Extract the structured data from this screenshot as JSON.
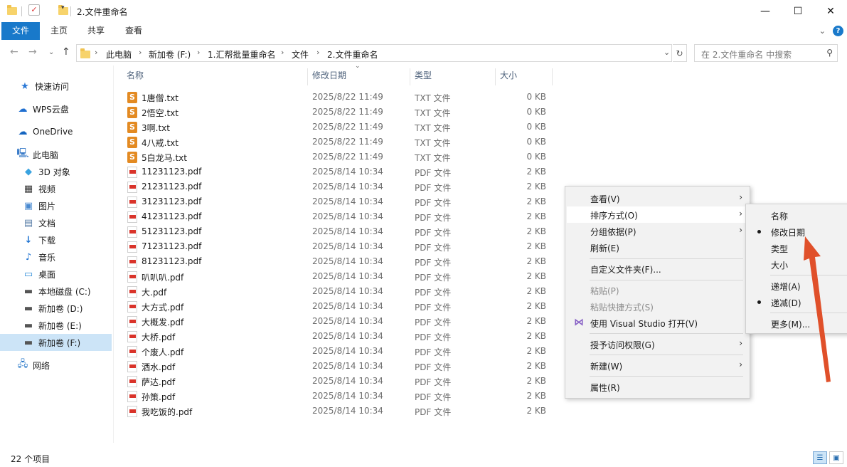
{
  "window": {
    "title": "2.文件重命名",
    "minimize": "—",
    "maximize": "☐",
    "close": "✕"
  },
  "ribbon": {
    "tabs": [
      "文件",
      "主页",
      "共享",
      "查看"
    ],
    "help": "?"
  },
  "address": {
    "segments": [
      "此电脑",
      "新加卷 (F:)",
      "1.汇帮批量重命名",
      "文件",
      "2.文件重命名"
    ],
    "search_placeholder": "在 2.文件重命名 中搜索"
  },
  "nav": {
    "items": [
      {
        "label": "快速访问",
        "icon": "star-icon"
      },
      {
        "label": "WPS云盘",
        "icon": "cloud-icon"
      },
      {
        "label": "OneDrive",
        "icon": "onedrive-icon"
      },
      {
        "label": "此电脑",
        "icon": "computer-icon"
      },
      {
        "label": "3D 对象",
        "icon": "cube-icon"
      },
      {
        "label": "视频",
        "icon": "film-icon"
      },
      {
        "label": "图片",
        "icon": "picture-icon"
      },
      {
        "label": "文档",
        "icon": "document-icon"
      },
      {
        "label": "下载",
        "icon": "download-icon"
      },
      {
        "label": "音乐",
        "icon": "music-icon"
      },
      {
        "label": "桌面",
        "icon": "desktop-icon"
      },
      {
        "label": "本地磁盘 (C:)",
        "icon": "drive-icon"
      },
      {
        "label": "新加卷 (D:)",
        "icon": "drive-icon"
      },
      {
        "label": "新加卷 (E:)",
        "icon": "drive-icon"
      },
      {
        "label": "新加卷 (F:)",
        "icon": "drive-icon"
      },
      {
        "label": "网络",
        "icon": "network-icon"
      }
    ]
  },
  "columns": [
    "名称",
    "修改日期",
    "类型",
    "大小"
  ],
  "files": [
    {
      "name": "1唐僧.txt",
      "date": "2025/8/22 11:49",
      "type": "TXT 文件",
      "size": "0 KB",
      "kind": "txt"
    },
    {
      "name": "2悟空.txt",
      "date": "2025/8/22 11:49",
      "type": "TXT 文件",
      "size": "0 KB",
      "kind": "txt"
    },
    {
      "name": "3啊.txt",
      "date": "2025/8/22 11:49",
      "type": "TXT 文件",
      "size": "0 KB",
      "kind": "txt"
    },
    {
      "name": "4八戒.txt",
      "date": "2025/8/22 11:49",
      "type": "TXT 文件",
      "size": "0 KB",
      "kind": "txt"
    },
    {
      "name": "5白龙马.txt",
      "date": "2025/8/22 11:49",
      "type": "TXT 文件",
      "size": "0 KB",
      "kind": "txt"
    },
    {
      "name": "11231123.pdf",
      "date": "2025/8/14 10:34",
      "type": "PDF 文件",
      "size": "2 KB",
      "kind": "pdf"
    },
    {
      "name": "21231123.pdf",
      "date": "2025/8/14 10:34",
      "type": "PDF 文件",
      "size": "2 KB",
      "kind": "pdf"
    },
    {
      "name": "31231123.pdf",
      "date": "2025/8/14 10:34",
      "type": "PDF 文件",
      "size": "2 KB",
      "kind": "pdf"
    },
    {
      "name": "41231123.pdf",
      "date": "2025/8/14 10:34",
      "type": "PDF 文件",
      "size": "2 KB",
      "kind": "pdf"
    },
    {
      "name": "51231123.pdf",
      "date": "2025/8/14 10:34",
      "type": "PDF 文件",
      "size": "2 KB",
      "kind": "pdf"
    },
    {
      "name": "71231123.pdf",
      "date": "2025/8/14 10:34",
      "type": "PDF 文件",
      "size": "2 KB",
      "kind": "pdf"
    },
    {
      "name": "81231123.pdf",
      "date": "2025/8/14 10:34",
      "type": "PDF 文件",
      "size": "2 KB",
      "kind": "pdf"
    },
    {
      "name": "叭叭叭.pdf",
      "date": "2025/8/14 10:34",
      "type": "PDF 文件",
      "size": "2 KB",
      "kind": "pdf"
    },
    {
      "name": "大.pdf",
      "date": "2025/8/14 10:34",
      "type": "PDF 文件",
      "size": "2 KB",
      "kind": "pdf"
    },
    {
      "name": "大方式.pdf",
      "date": "2025/8/14 10:34",
      "type": "PDF 文件",
      "size": "2 KB",
      "kind": "pdf"
    },
    {
      "name": "大概发.pdf",
      "date": "2025/8/14 10:34",
      "type": "PDF 文件",
      "size": "2 KB",
      "kind": "pdf"
    },
    {
      "name": "大桥.pdf",
      "date": "2025/8/14 10:34",
      "type": "PDF 文件",
      "size": "2 KB",
      "kind": "pdf"
    },
    {
      "name": "个废人.pdf",
      "date": "2025/8/14 10:34",
      "type": "PDF 文件",
      "size": "2 KB",
      "kind": "pdf"
    },
    {
      "name": "洒水.pdf",
      "date": "2025/8/14 10:34",
      "type": "PDF 文件",
      "size": "2 KB",
      "kind": "pdf"
    },
    {
      "name": "萨达.pdf",
      "date": "2025/8/14 10:34",
      "type": "PDF 文件",
      "size": "2 KB",
      "kind": "pdf"
    },
    {
      "name": "孙策.pdf",
      "date": "2025/8/14 10:34",
      "type": "PDF 文件",
      "size": "2 KB",
      "kind": "pdf"
    },
    {
      "name": "我吃饭的.pdf",
      "date": "2025/8/14 10:34",
      "type": "PDF 文件",
      "size": "2 KB",
      "kind": "pdf"
    }
  ],
  "status": {
    "count": "22 个项目"
  },
  "context_menu": {
    "view": "查看(V)",
    "sort": "排序方式(O)",
    "group": "分组依据(P)",
    "refresh": "刷新(E)",
    "customize": "自定义文件夹(F)...",
    "paste": "粘贴(P)",
    "paste_shortcut": "粘贴快捷方式(S)",
    "open_vs": "使用 Visual Studio 打开(V)",
    "grant_access": "授予访问权限(G)",
    "new": "新建(W)",
    "properties": "属性(R)"
  },
  "sort_submenu": {
    "name": "名称",
    "date": "修改日期",
    "type": "类型",
    "size": "大小",
    "asc": "递增(A)",
    "desc": "递减(D)",
    "more": "更多(M)..."
  },
  "colors": {
    "accent": "#1979ca",
    "selection": "#cce4f7",
    "annotation": "#e0502a"
  }
}
